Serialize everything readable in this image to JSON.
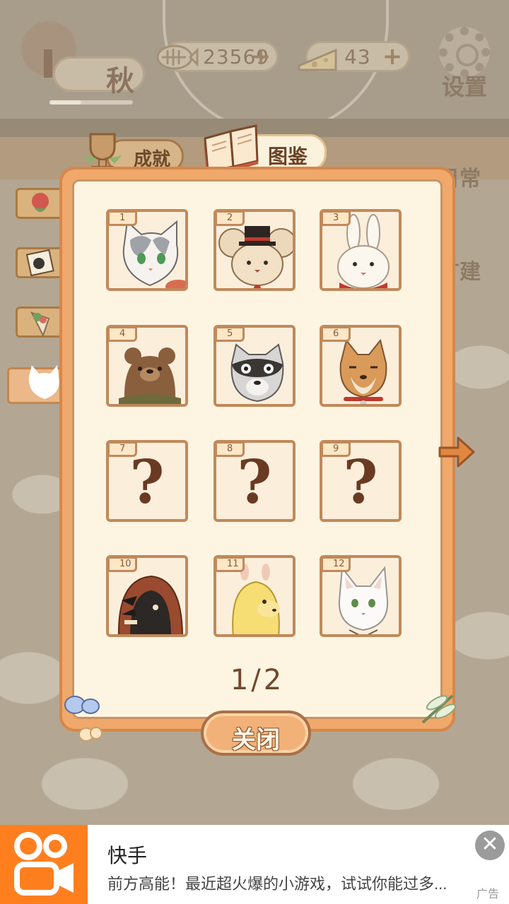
{
  "hud": {
    "season_label": "秋",
    "fish_bones": "23569",
    "cheese": "43",
    "settings_label": "设置",
    "right_labels": [
      "日常",
      "扩建"
    ]
  },
  "tabs": {
    "achievements": "成就",
    "encyclopedia": "图鉴"
  },
  "side_tabs": [
    {
      "icon": "rose-icon"
    },
    {
      "icon": "photo-icon"
    },
    {
      "icon": "bouquet-icon"
    },
    {
      "icon": "cat-silhouette-icon"
    }
  ],
  "collection": {
    "cells": [
      {
        "num": "1",
        "state": "unlocked",
        "character": "gray-white-cat"
      },
      {
        "num": "2",
        "state": "unlocked",
        "character": "mouse-with-top-hat"
      },
      {
        "num": "3",
        "state": "unlocked",
        "character": "white-rabbit"
      },
      {
        "num": "4",
        "state": "unlocked",
        "character": "brown-bear"
      },
      {
        "num": "5",
        "state": "unlocked",
        "character": "raccoon"
      },
      {
        "num": "6",
        "state": "unlocked",
        "character": "shiba-dog"
      },
      {
        "num": "7",
        "state": "locked",
        "mark": "?"
      },
      {
        "num": "8",
        "state": "locked",
        "mark": "?"
      },
      {
        "num": "9",
        "state": "locked",
        "mark": "?"
      },
      {
        "num": "10",
        "state": "unlocked",
        "character": "hooded-crow"
      },
      {
        "num": "11",
        "state": "unlocked",
        "character": "alpaca"
      },
      {
        "num": "12",
        "state": "unlocked",
        "character": "white-fox"
      }
    ],
    "page_indicator": "1/2",
    "close_label": "关闭"
  },
  "ad": {
    "title": "快手",
    "description": "前方高能！最近超火爆的小游戏，试试你能过多...",
    "close_glyph": "✕",
    "tag": "广告",
    "brand_color": "#ff7f1f"
  }
}
